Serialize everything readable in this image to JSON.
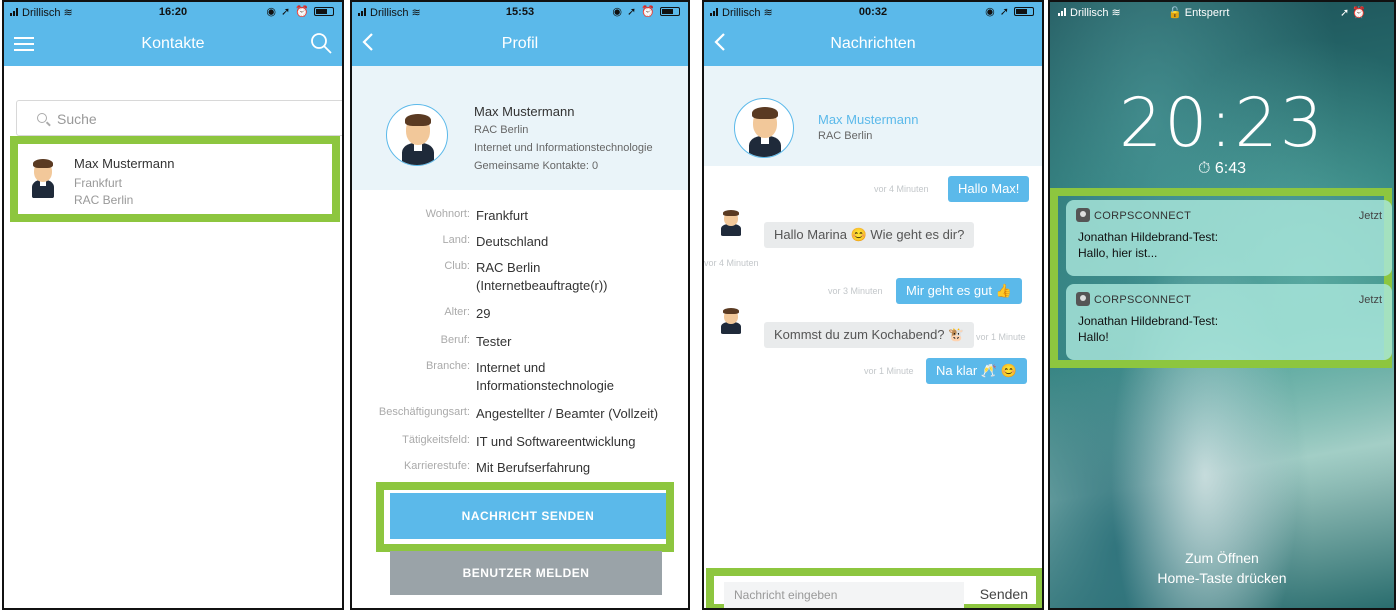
{
  "colors": {
    "accent": "#5bb9ea",
    "highlight": "#8dc63f",
    "grey_button": "#9aa3a8"
  },
  "screen1": {
    "status": {
      "carrier": "Drillisch",
      "time": "16:20"
    },
    "title": "Kontakte",
    "menu_icon": "hamburger-icon",
    "search_icon": "search-icon",
    "search_placeholder": "Suche",
    "contact": {
      "name": "Max Mustermann",
      "city": "Frankfurt",
      "club": "RAC Berlin"
    }
  },
  "screen2": {
    "status": {
      "carrier": "Drillisch",
      "time": "15:53"
    },
    "title": "Profil",
    "back_icon": "chevron-left-icon",
    "profile": {
      "name": "Max Mustermann",
      "club": "RAC Berlin",
      "industry": "Internet und Informationstechnologie",
      "mutual": "Gemeinsame Kontakte: 0"
    },
    "details": [
      {
        "label": "Wohnort:",
        "value": "Frankfurt"
      },
      {
        "label": "Land:",
        "value": "Deutschland"
      },
      {
        "label": "Club:",
        "value": "RAC Berlin",
        "value2": "(Internetbeauftragte(r))"
      },
      {
        "label": "Alter:",
        "value": "29"
      },
      {
        "label": "Beruf:",
        "value": "Tester"
      },
      {
        "label": "Branche:",
        "value": "Internet und",
        "value2": "Informationstechnologie"
      },
      {
        "label": "Beschäftigungsart:",
        "value": "Angestellter / Beamter (Vollzeit)"
      },
      {
        "label": "Tätigkeitsfeld:",
        "value": "IT und Softwareentwicklung"
      },
      {
        "label": "Karrierestufe:",
        "value": "Mit Berufserfahrung"
      }
    ],
    "send_button": "NACHRICHT SENDEN",
    "report_button": "BENUTZER MELDEN"
  },
  "screen3": {
    "status": {
      "carrier": "Drillisch",
      "time": "00:32"
    },
    "title": "Nachrichten",
    "back_icon": "chevron-left-icon",
    "partner": {
      "name": "Max Mustermann",
      "club": "RAC Berlin"
    },
    "messages": [
      {
        "dir": "out",
        "text": "Hallo Max!",
        "time": "vor 4 Minuten"
      },
      {
        "dir": "in",
        "text": "Hallo Marina 😊 Wie geht es dir?",
        "time": "vor 4 Minuten"
      },
      {
        "dir": "out",
        "text": "Mir geht es gut 👍",
        "time": "vor 3 Minuten"
      },
      {
        "dir": "in",
        "text": "Kommst du zum Kochabend? 🐮",
        "time": "vor 1 Minute"
      },
      {
        "dir": "out",
        "text": "Na klar 🥂 😊",
        "time": "vor 1 Minute"
      }
    ],
    "input_placeholder": "Nachricht eingeben",
    "send_label": "Senden"
  },
  "screen4": {
    "status": {
      "carrier": "Drillisch",
      "lock_state": "Entsperrt"
    },
    "time": "20:23",
    "alarm": "6:43",
    "notifications": [
      {
        "app": "CORPSCONNECT",
        "when": "Jetzt",
        "title": "Jonathan Hildebrand-Test:",
        "body": "Hallo, hier ist..."
      },
      {
        "app": "CORPSCONNECT",
        "when": "Jetzt",
        "title": "Jonathan Hildebrand-Test:",
        "body": "Hallo!"
      }
    ],
    "hint_line1": "Zum Öffnen",
    "hint_line2": "Home-Taste drücken"
  }
}
